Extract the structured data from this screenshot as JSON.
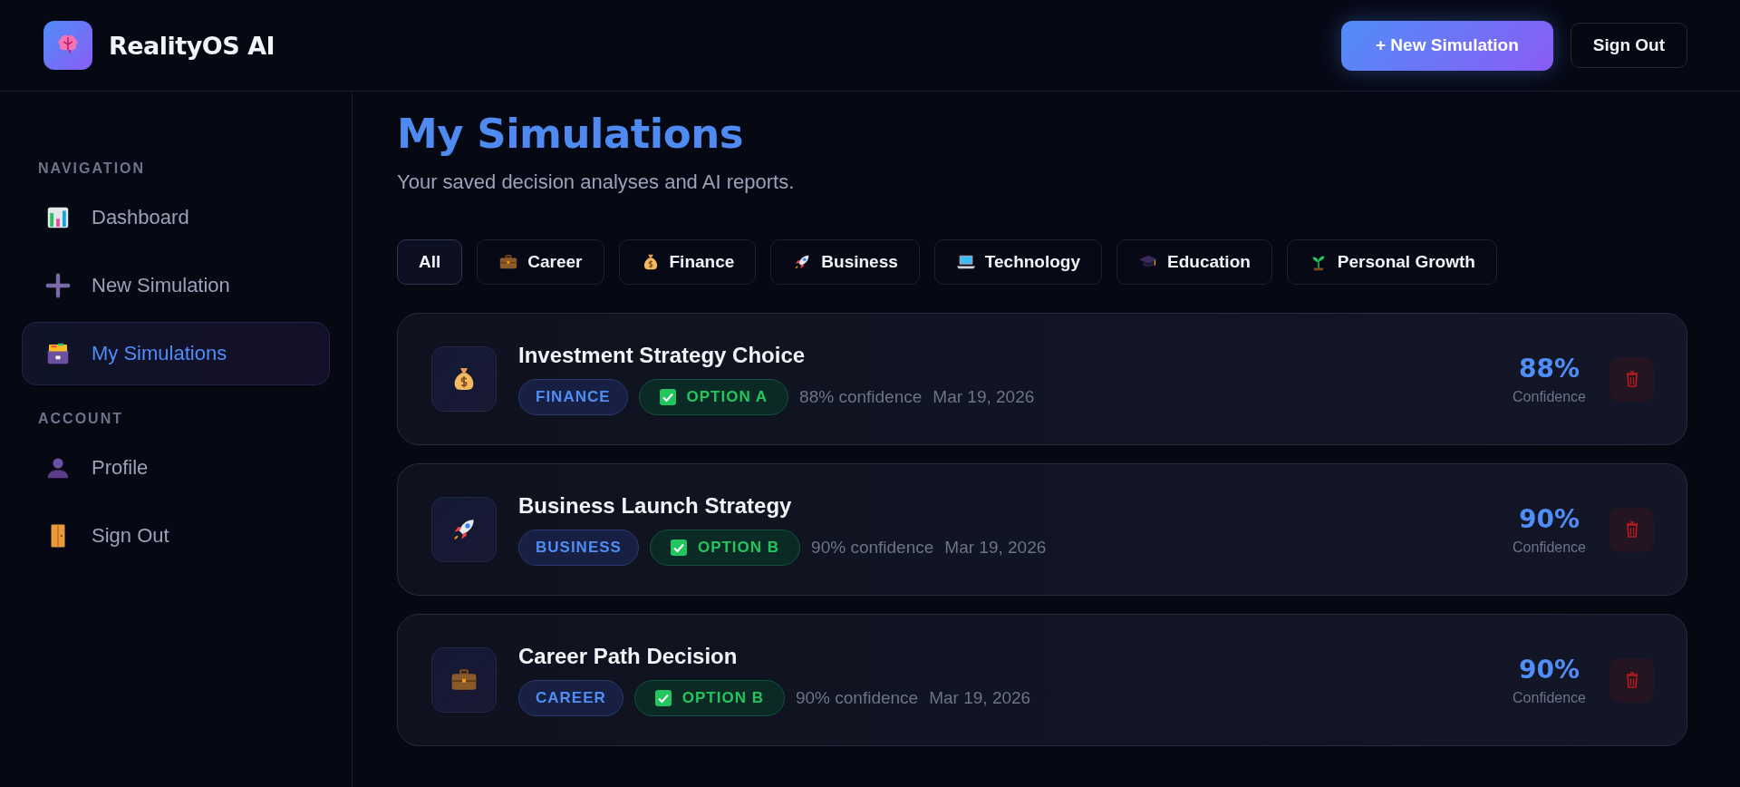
{
  "header": {
    "title": "RealityOS AI",
    "new_button": "+ New Simulation",
    "signout_button": "Sign Out"
  },
  "sidebar": {
    "sections": [
      {
        "label": "NAVIGATION",
        "items": [
          {
            "label": "Dashboard",
            "selected": false
          },
          {
            "label": "New Simulation",
            "selected": false
          },
          {
            "label": "My Simulations",
            "selected": true
          }
        ]
      },
      {
        "label": "ACCOUNT",
        "items": [
          {
            "label": "Profile",
            "selected": false
          },
          {
            "label": "Sign Out",
            "selected": false
          }
        ]
      }
    ]
  },
  "page": {
    "title": "My Simulations",
    "subtitle": "Your saved decision analyses and AI reports."
  },
  "filters": [
    {
      "label": "All",
      "selected": true
    },
    {
      "label": "Career",
      "selected": false
    },
    {
      "label": "Finance",
      "selected": false
    },
    {
      "label": "Business",
      "selected": false
    },
    {
      "label": "Technology",
      "selected": false
    },
    {
      "label": "Education",
      "selected": false
    },
    {
      "label": "Personal Growth",
      "selected": false
    }
  ],
  "simulations": [
    {
      "kind": "finance",
      "title": "Investment Strategy Choice",
      "category": "FINANCE",
      "option": "OPTION A",
      "confidence_text": "88% confidence",
      "date": "Mar 19, 2026",
      "percent": "88%",
      "percent_label": "Confidence"
    },
    {
      "kind": "business",
      "title": "Business Launch Strategy",
      "category": "BUSINESS",
      "option": "OPTION B",
      "confidence_text": "90% confidence",
      "date": "Mar 19, 2026",
      "percent": "90%",
      "percent_label": "Confidence"
    },
    {
      "kind": "career",
      "title": "Career Path Decision",
      "category": "CAREER",
      "option": "OPTION B",
      "confidence_text": "90% confidence",
      "date": "Mar 19, 2026",
      "percent": "90%",
      "percent_label": "Confidence"
    }
  ]
}
